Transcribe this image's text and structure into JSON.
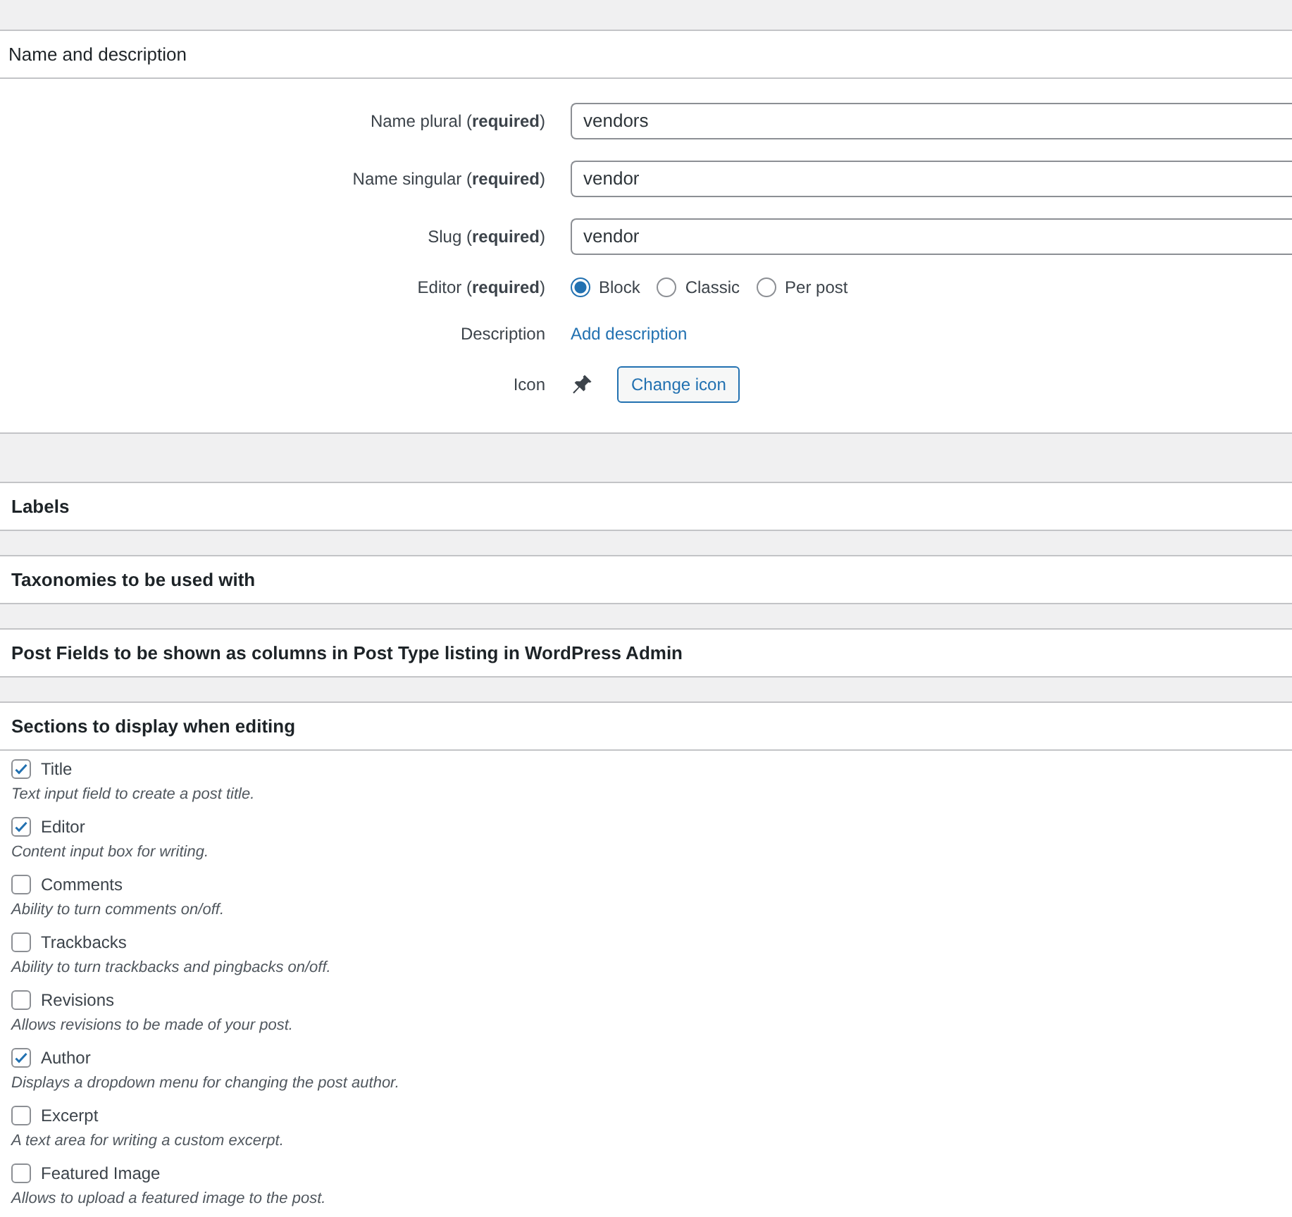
{
  "name_section": {
    "title": "Name and description",
    "rows": [
      {
        "kind": "text",
        "label": "Name plural (**required**)",
        "value": "vendors"
      },
      {
        "kind": "text",
        "label": "Name singular (**required**)",
        "value": "vendor"
      },
      {
        "kind": "text",
        "label": "Slug (**required**)",
        "value": "vendor"
      },
      {
        "kind": "radio",
        "label": "Editor (**required**)",
        "options": [
          {
            "label": "Block",
            "selected": true
          },
          {
            "label": "Classic",
            "selected": false
          },
          {
            "label": "Per post",
            "selected": false
          }
        ]
      },
      {
        "kind": "link",
        "label": "Description",
        "link": "Add description"
      },
      {
        "kind": "icon",
        "label": "Icon",
        "button": "Change icon"
      }
    ]
  },
  "collapsed_sections": [
    {
      "title": "Labels"
    },
    {
      "title": "Taxonomies to be used with"
    },
    {
      "title": "Post Fields to be shown as columns in Post Type listing in WordPress Admin"
    }
  ],
  "editing_section": {
    "title": "Sections to display when editing",
    "items": [
      {
        "label": "Title",
        "checked": true,
        "description": "Text input field to create a post title."
      },
      {
        "label": "Editor",
        "checked": true,
        "description": "Content input box for writing."
      },
      {
        "label": "Comments",
        "checked": false,
        "description": "Ability to turn comments on/off."
      },
      {
        "label": "Trackbacks",
        "checked": false,
        "description": "Ability to turn trackbacks and pingbacks on/off."
      },
      {
        "label": "Revisions",
        "checked": false,
        "description": "Allows revisions to be made of your post."
      },
      {
        "label": "Author",
        "checked": true,
        "description": "Displays a dropdown menu for changing the post author."
      },
      {
        "label": "Excerpt",
        "checked": false,
        "description": "A text area for writing a custom excerpt."
      },
      {
        "label": "Featured Image",
        "checked": false,
        "description": "Allows to upload a featured image to the post."
      }
    ]
  }
}
